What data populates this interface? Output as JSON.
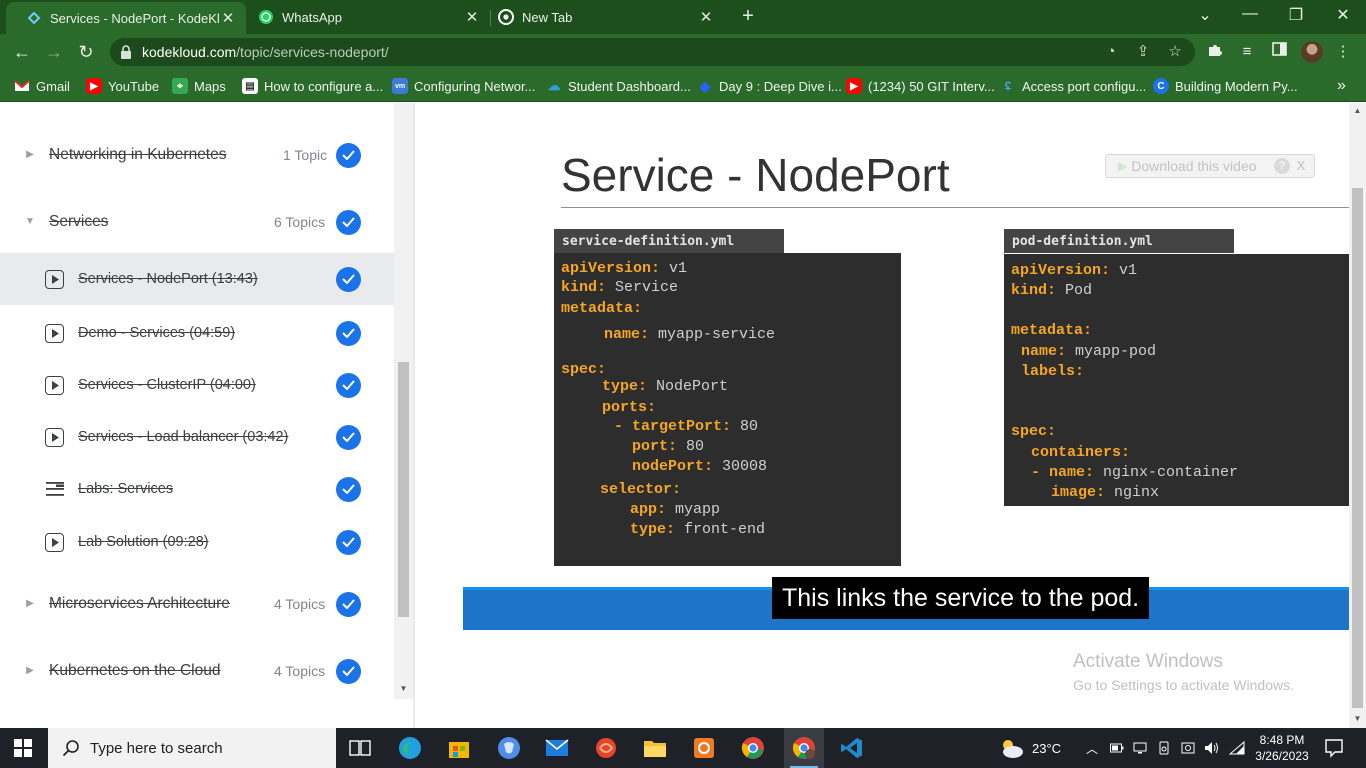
{
  "browser": {
    "tabs": [
      {
        "title": "Services - NodePort - KodeKloud",
        "icon": "kodekloud-favicon",
        "active": true
      },
      {
        "title": "WhatsApp",
        "icon": "whatsapp-favicon",
        "active": false
      },
      {
        "title": "New Tab",
        "icon": "chrome-favicon",
        "active": false
      }
    ],
    "url_host": "kodekloud.com",
    "url_path": "/topic/services-nodeport/",
    "bookmarks": [
      {
        "label": "Gmail",
        "icon": "gmail-icon",
        "color": "#d93025"
      },
      {
        "label": "YouTube",
        "icon": "youtube-icon",
        "color": "#ff0000"
      },
      {
        "label": "Maps",
        "icon": "maps-icon",
        "color": "#34a853"
      },
      {
        "label": "How to configure a...",
        "icon": "page-icon",
        "color": "#ffffff"
      },
      {
        "label": "Configuring Networ...",
        "icon": "vmware-icon",
        "color": "#3c7bd6"
      },
      {
        "label": "Student Dashboard...",
        "icon": "cloud-icon",
        "color": "#2aa0d8"
      },
      {
        "label": "Day 9 : Deep Dive i...",
        "icon": "diamond-icon",
        "color": "#2962ff"
      },
      {
        "label": "(1234) 50 GIT Interv...",
        "icon": "youtube-icon",
        "color": "#ff0000"
      },
      {
        "label": "Access port configu...",
        "icon": "cisco-icon",
        "color": "#4aa3df"
      },
      {
        "label": "Building Modern Py...",
        "icon": "c-icon",
        "color": "#1a73e8"
      }
    ],
    "more_bookmarks": "»"
  },
  "sidebar": {
    "items": [
      {
        "type": "section",
        "title": "Networking in Kubernetes",
        "count": "1 Topic",
        "expanded": false,
        "done": true
      },
      {
        "type": "section",
        "title": "Services",
        "count": "6 Topics",
        "expanded": true,
        "done": true
      },
      {
        "type": "video",
        "title": "Services - NodePort (13:43)",
        "current": true,
        "done": true
      },
      {
        "type": "video",
        "title": "Demo - Services (04:59)",
        "done": true
      },
      {
        "type": "video",
        "title": "Services - ClusterIP (04:00)",
        "done": true
      },
      {
        "type": "video",
        "title": "Services - Load balancer (03:42)",
        "done": true
      },
      {
        "type": "lab",
        "title": "Labs: Services",
        "done": true
      },
      {
        "type": "video",
        "title": "Lab Solution (09:28)",
        "done": true
      },
      {
        "type": "section",
        "title": "Microservices Architecture",
        "count": "4 Topics",
        "expanded": false,
        "done": true
      },
      {
        "type": "section",
        "title": "Kubernetes on the Cloud",
        "count": "4 Topics",
        "expanded": false,
        "done": true
      }
    ]
  },
  "video": {
    "slide_title": "Service - NodePort",
    "download_label": "Download this video",
    "download_help": "?",
    "download_close": "X",
    "service_file": {
      "filename": "service-definition.yml",
      "lines": [
        {
          "key": "apiVersion:",
          "value": " v1"
        },
        {
          "key": "kind:",
          "value": " Service"
        },
        {
          "key": "metadata:",
          "value": ""
        },
        {
          "key": "name:",
          "value": " myapp-service"
        },
        {
          "key": "spec:",
          "value": ""
        },
        {
          "key": "type:",
          "value": " NodePort"
        },
        {
          "key": "ports:",
          "value": ""
        },
        {
          "key": "- targetPort:",
          "value": " 80"
        },
        {
          "key": "port:",
          "value": " 80"
        },
        {
          "key": "nodePort:",
          "value": " 30008"
        },
        {
          "key": "selector:",
          "value": ""
        },
        {
          "key": "app:",
          "value": " myapp"
        },
        {
          "key": "type:",
          "value": " front-end"
        }
      ]
    },
    "pod_file": {
      "filename": "pod-definition.yml",
      "lines": [
        {
          "key": "apiVersion:",
          "value": " v1"
        },
        {
          "key": "kind:",
          "value": " Pod"
        },
        {
          "key": "metadata:",
          "value": ""
        },
        {
          "key": "name:",
          "value": " myapp-pod"
        },
        {
          "key": "labels:",
          "value": ""
        },
        {
          "key": "spec:",
          "value": ""
        },
        {
          "key": "containers:",
          "value": ""
        },
        {
          "key": "- name:",
          "value": " nginx-container"
        },
        {
          "key": "image:",
          "value": " nginx"
        }
      ]
    },
    "caption": "This links the service to the pod.",
    "activate_title": "Activate Windows",
    "activate_sub": "Go to Settings to activate Windows."
  },
  "taskbar": {
    "search_placeholder": "Type here to search",
    "weather": "23°C",
    "time": "8:48 PM",
    "date": "3/26/2023"
  }
}
